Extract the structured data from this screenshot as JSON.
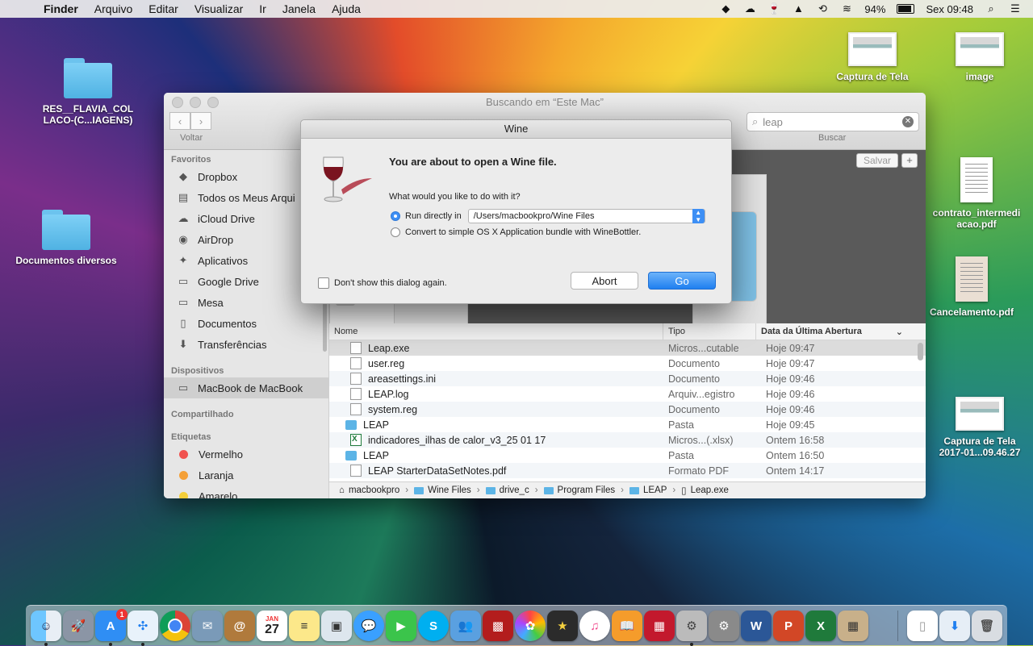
{
  "menubar": {
    "app": "Finder",
    "items": [
      "Arquivo",
      "Editar",
      "Visualizar",
      "Ir",
      "Janela",
      "Ajuda"
    ],
    "battery": "94%",
    "clock": "Sex 09:48"
  },
  "desktop": {
    "folder1": "RES__FLAVIA_COL LACO-(C...IAGENS)",
    "folder2": "Documentos diversos",
    "capture1": "Captura de Tela",
    "image": "image",
    "contract": "contrato_intermedi acao.pdf",
    "cancel": "Cancelamento.pdf",
    "capture2_line1": "Captura de Tela",
    "capture2_line2": "2017-01...09.46.27"
  },
  "finder": {
    "title": "Buscando em “Este Mac”",
    "back_label": "Voltar",
    "search_value": "leap",
    "search_label": "Buscar",
    "save_label": "Salvar",
    "sidebar": {
      "favorites_heading": "Favoritos",
      "favorites": [
        "Dropbox",
        "Todos os Meus Arqui",
        "iCloud Drive",
        "AirDrop",
        "Aplicativos",
        "Google Drive",
        "Mesa",
        "Documentos",
        "Transferências"
      ],
      "devices_heading": "Dispositivos",
      "device": "MacBook de MacBook",
      "shared_heading": "Compartilhado",
      "tags_heading": "Etiquetas",
      "tags": [
        "Vermelho",
        "Laranja",
        "Amarelo"
      ]
    },
    "columns": {
      "name": "Nome",
      "kind": "Tipo",
      "date": "Data da Última Abertura"
    },
    "rows": [
      {
        "name": "Leap.exe",
        "kind": "Micros...cutable",
        "date": "Hoje 09:47"
      },
      {
        "name": "user.reg",
        "kind": "Documento",
        "date": "Hoje 09:47"
      },
      {
        "name": "areasettings.ini",
        "kind": "Documento",
        "date": "Hoje 09:46"
      },
      {
        "name": "LEAP.log",
        "kind": "Arquiv...egistro",
        "date": "Hoje 09:46"
      },
      {
        "name": "system.reg",
        "kind": "Documento",
        "date": "Hoje 09:46"
      },
      {
        "name": "LEAP",
        "kind": "Pasta",
        "date": "Hoje 09:45"
      },
      {
        "name": "indicadores_ilhas de calor_v3_25 01 17",
        "kind": "Micros...(.xlsx)",
        "date": "Ontem 16:58"
      },
      {
        "name": "LEAP",
        "kind": "Pasta",
        "date": "Ontem 16:50"
      },
      {
        "name": "LEAP StarterDataSetNotes.pdf",
        "kind": "Formato PDF",
        "date": "Ontem 14:17"
      }
    ],
    "path": [
      "macbookpro",
      "Wine Files",
      "drive_c",
      "Program Files",
      "LEAP",
      "Leap.exe"
    ]
  },
  "dialog": {
    "title": "Wine",
    "heading": "You are about to open a Wine file.",
    "question": "What would you like to do with it?",
    "option1": "Run directly in",
    "path_value": "/Users/macbookpro/Wine Files",
    "option2": "Convert to simple OS X Application bundle with WineBottler.",
    "checkbox": "Don't show this dialog again.",
    "abort": "Abort",
    "go": "Go"
  },
  "dock": {
    "calendar_month": "JAN",
    "calendar_day": "27",
    "appstore_badge": "1"
  }
}
